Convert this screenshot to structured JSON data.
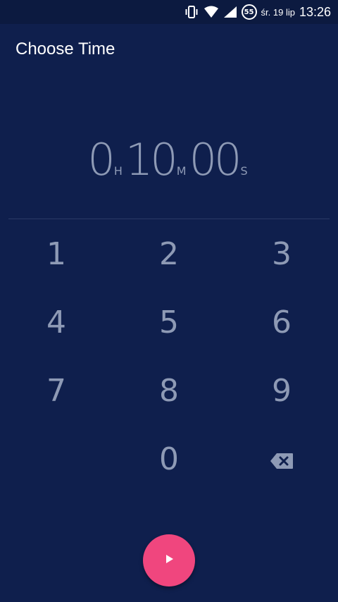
{
  "status_bar": {
    "battery_level": "55",
    "date": "śr. 19 lip",
    "time": "13:26",
    "icons": [
      "vibrate-icon",
      "wifi-icon",
      "signal-icon",
      "battery-icon"
    ]
  },
  "toolbar": {
    "title": "Choose Time"
  },
  "timer": {
    "hours": "0",
    "hours_unit": "H",
    "minutes": "10",
    "minutes_unit": "M",
    "seconds": "00",
    "seconds_unit": "S"
  },
  "keypad": {
    "keys": [
      "1",
      "2",
      "3",
      "4",
      "5",
      "6",
      "7",
      "8",
      "9",
      "0"
    ],
    "backspace_icon": "backspace-icon"
  },
  "fab": {
    "icon": "play-icon"
  },
  "colors": {
    "background": "#0f1f4d",
    "status_bar": "#0c1a40",
    "digit_text": "#8e9ab5",
    "accent": "#f0467e"
  }
}
